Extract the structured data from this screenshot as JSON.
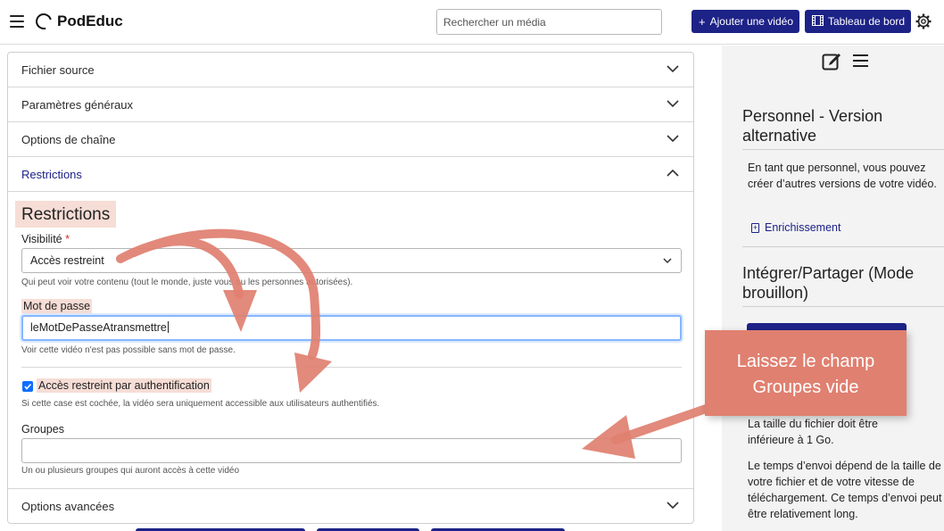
{
  "header": {
    "app_name": "PodEduc",
    "search_placeholder": "Rechercher un média",
    "add_video_label": "Ajouter une vidéo",
    "dashboard_label": "Tableau de bord"
  },
  "form": {
    "sections": [
      {
        "label": "Fichier source"
      },
      {
        "label": "Paramètres généraux"
      },
      {
        "label": "Options de chaîne"
      },
      {
        "label": "Restrictions"
      }
    ],
    "restrictions": {
      "title": "Restrictions",
      "visibility_label": "Visibilité",
      "visibility_required": "*",
      "visibility_value": "Accès restreint",
      "visibility_help": "Qui peut voir votre contenu (tout le monde, juste vous ou les personnes autorisées).",
      "password_label": "Mot de passe",
      "password_value": "leMotDePasseAtransmettre",
      "password_help": "Voir cette vidéo n'est pas possible sans mot de passe.",
      "auth_checkbox_label": "Accès restreint par authentification",
      "auth_checkbox_checked": true,
      "auth_help": "Si cette case est cochée, la vidéo sera uniquement accessible aux utilisateurs authentifiés.",
      "groups_label": "Groupes",
      "groups_value": "",
      "groups_help": "Un ou plusieurs groupes qui auront accès à cette vidéo"
    },
    "advanced_label": "Options avancées"
  },
  "sidebar": {
    "personal_title": "Personnel - Version alternative",
    "personal_text": "En tant que personnel, vous pouvez créer d’autres versions de votre vidéo.",
    "enrich_link": "Enrichissement",
    "embed_title": "Intégrer/Partager (Mode brouillon)",
    "filesize_text": "La taille du fichier doit être inférieure à 1 Go.",
    "upload_text": "Le temps d’envoi dépend de la taille de votre fichier et de votre vitesse de téléchargement. Ce temps d’envoi peut être relativement long."
  },
  "annotation": {
    "callout_text": "Laissez le champ Groupes vide"
  },
  "colors": {
    "primary": "#1d2287",
    "highlight": "#f6ddd6",
    "callout": "#e08070",
    "checkbox": "#0d6efd"
  }
}
